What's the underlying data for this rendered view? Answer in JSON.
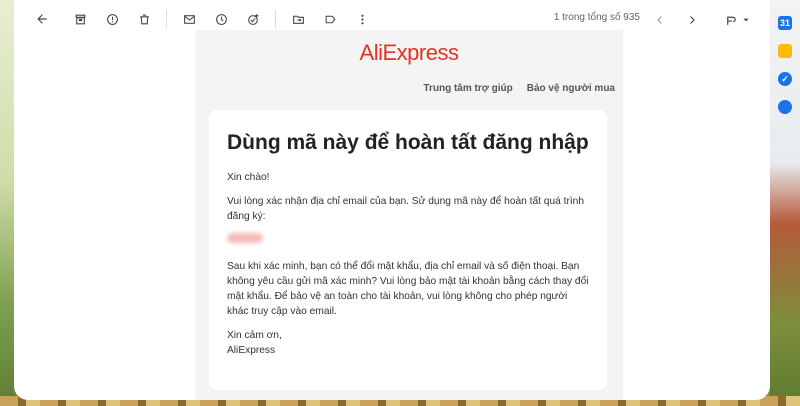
{
  "toolbar": {
    "icons": [
      "back-arrow-icon",
      "archive-icon",
      "report-spam-icon",
      "delete-icon",
      "mark-unread-icon",
      "snooze-icon",
      "add-task-icon",
      "move-to-icon",
      "label-icon",
      "more-vert-icon"
    ],
    "pager_text": "1 trong tổng số 935"
  },
  "email": {
    "brand": "AliExpress",
    "links": [
      "Trung tâm trợ giúp",
      "Bảo vệ người mua"
    ],
    "heading": "Dùng mã này để hoàn tất đăng nhập",
    "greeting": "Xin chào!",
    "intro": "Vui lòng xác nhận địa chỉ email của bạn. Sử dụng mã này để hoàn tất quá trình đăng ký:",
    "after_verify": "Sau khi xác minh, bạn có thể đổi mật khẩu, địa chỉ email và số điện thoại. Bạn không yêu cầu gửi mã xác minh? Vui lòng bảo mật tài khoản bằng cách thay đổi mật khẩu. Để bảo vệ an toàn cho tài khoản, vui lòng không cho phép người khác truy cập vào email.",
    "thanks": "Xin cảm ơn,",
    "signature": "AliExpress"
  },
  "colors": {
    "brand": "#e43225"
  }
}
